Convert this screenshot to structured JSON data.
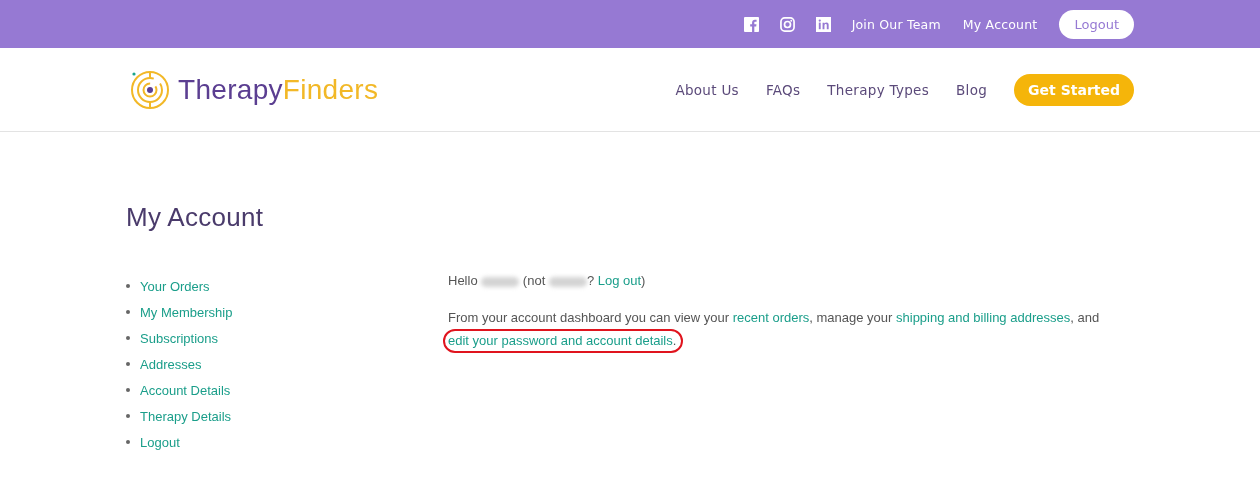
{
  "top_bar": {
    "social": [
      {
        "kind": "facebook"
      },
      {
        "kind": "instagram"
      },
      {
        "kind": "linkedin"
      }
    ],
    "links": [
      "Join Our Team",
      "My Account"
    ],
    "button": "Logout"
  },
  "header": {
    "logo": {
      "part_1": "Therapy",
      "part_2": "Finders"
    },
    "nav": [
      "About Us",
      "FAQs",
      "Therapy Types",
      "Blog"
    ],
    "cta": "Get Started"
  },
  "page_title": "My Account",
  "account_nav": [
    "Your Orders",
    "My Membership",
    "Subscriptions",
    "Addresses",
    "Account Details",
    "Therapy Details",
    "Logout"
  ],
  "greeting": [
    {
      "kind": "text",
      "text": "Hello "
    },
    {
      "kind": "redacted"
    },
    {
      "kind": "text",
      "text": " (not "
    },
    {
      "kind": "redacted"
    },
    {
      "kind": "text",
      "text": "? "
    },
    {
      "kind": "link",
      "text": "Log out"
    },
    {
      "kind": "text",
      "text": ")"
    }
  ],
  "intro": [
    {
      "kind": "text",
      "text": "From your account dashboard you can view your "
    },
    {
      "kind": "link",
      "text": "recent orders",
      "highlighted": false
    },
    {
      "kind": "text",
      "text": ", manage your "
    },
    {
      "kind": "link",
      "text": "shipping and billing addresses",
      "highlighted": false
    },
    {
      "kind": "text",
      "text": ", and "
    },
    {
      "kind": "link",
      "text": "edit your password and account details",
      "highlighted": true
    },
    {
      "kind": "text",
      "text": "."
    }
  ]
}
